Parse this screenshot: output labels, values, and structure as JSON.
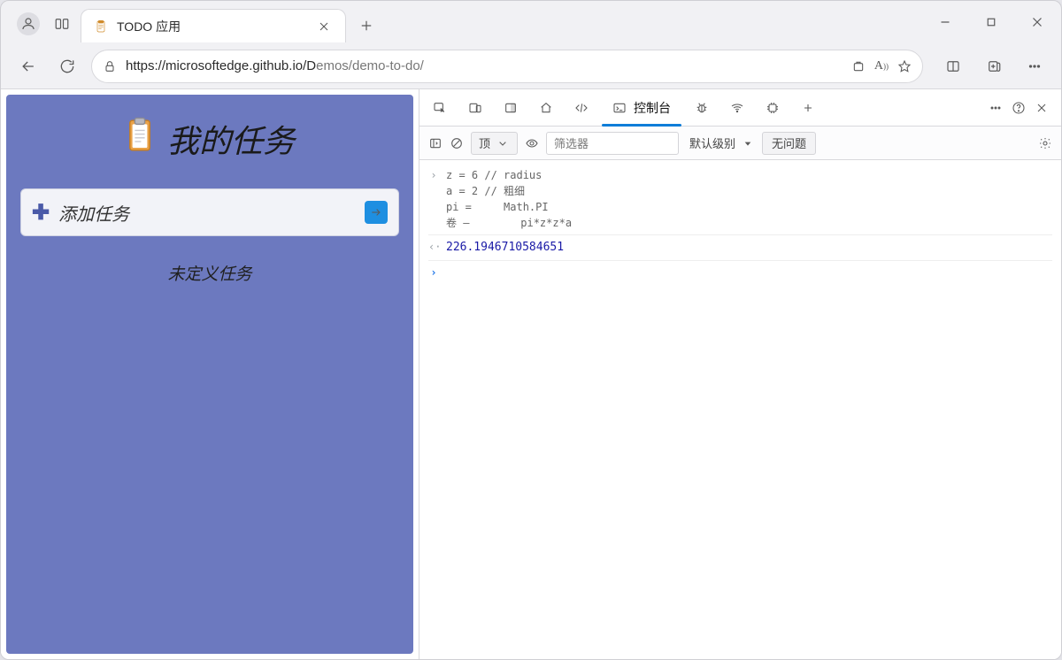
{
  "window": {
    "tab_title": "TODO 应用",
    "url_display": "https://microsoftedge.github.io/Demos/demo-to-do/",
    "url_host_end_index": 33
  },
  "app": {
    "title": "我的任务",
    "input_placeholder": "添加任务",
    "empty_state": "未定义任务"
  },
  "devtools": {
    "tabs": {
      "console_label": "控制台"
    },
    "toolbar": {
      "context_label": "顶",
      "filter_placeholder": "筛选器",
      "level_label": "默认级别",
      "issues_label": "无问题"
    },
    "console": {
      "in_lines": "z = 6 // radius\na = 2 // 粗细\npi =     Math.PI\n卷 —        pi*z*z*a",
      "out_value": "226.1946710584651"
    }
  }
}
